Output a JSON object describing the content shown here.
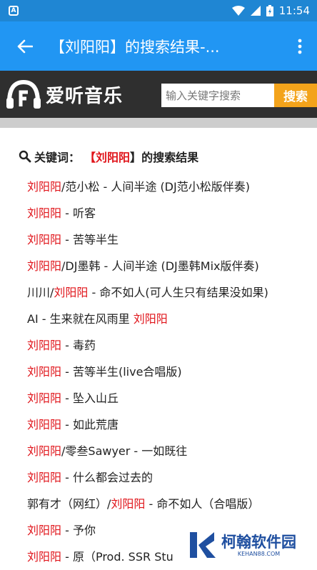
{
  "status_bar": {
    "notification_badge": "A",
    "time": "11:54"
  },
  "app_bar": {
    "title": "【刘阳阳】的搜索结果-..."
  },
  "site": {
    "logo_text": "爱听音乐",
    "search_placeholder": "输入关键字搜索",
    "search_button": "搜索"
  },
  "keyword_line": {
    "prefix": "关键词：",
    "open_bracket": "【",
    "keyword": "刘阳阳",
    "close_bracket": "】",
    "suffix": "的搜索结果"
  },
  "results": [
    {
      "before": "",
      "highlight": "刘阳阳",
      "after": "/范小松 - 人间半途 (DJ范小松版伴奏)"
    },
    {
      "before": "",
      "highlight": "刘阳阳",
      "after": " - 听客"
    },
    {
      "before": "",
      "highlight": "刘阳阳",
      "after": " - 苦等半生"
    },
    {
      "before": "",
      "highlight": "刘阳阳",
      "after": "/DJ墨韩 - 人间半途 (DJ墨韩Mix版伴奏)"
    },
    {
      "before": "川川/",
      "highlight": "刘阳阳",
      "after": " - 命不如人(可人生只有结果没如果)"
    },
    {
      "before": "AI - 生来就在风雨里 ",
      "highlight": "刘阳阳",
      "after": ""
    },
    {
      "before": "",
      "highlight": "刘阳阳",
      "after": " - 毒药"
    },
    {
      "before": "",
      "highlight": "刘阳阳",
      "after": " - 苦等半生(live合唱版)"
    },
    {
      "before": "",
      "highlight": "刘阳阳",
      "after": " - 坠入山丘"
    },
    {
      "before": "",
      "highlight": "刘阳阳",
      "after": " - 如此荒唐"
    },
    {
      "before": "",
      "highlight": "刘阳阳",
      "after": "/零叁Sawyer - 一如既往"
    },
    {
      "before": "",
      "highlight": "刘阳阳",
      "after": " - 什么都会过去的"
    },
    {
      "before": "郭有才（网红）/",
      "highlight": "刘阳阳",
      "after": " - 命不如人（合唱版）"
    },
    {
      "before": "",
      "highlight": "刘阳阳",
      "after": " - 予你"
    },
    {
      "before": "",
      "highlight": "刘阳阳",
      "after": " - 原（Prod. SSR Stu"
    }
  ],
  "watermark": {
    "main": "柯翰软件园",
    "sub": "KEHAN88.COM"
  },
  "colors": {
    "status_bar": "#1f86d3",
    "app_bar": "#2196f3",
    "highlight": "#e0141a",
    "search_button": "#f3a31b",
    "site_header": "#2f2f2f"
  }
}
